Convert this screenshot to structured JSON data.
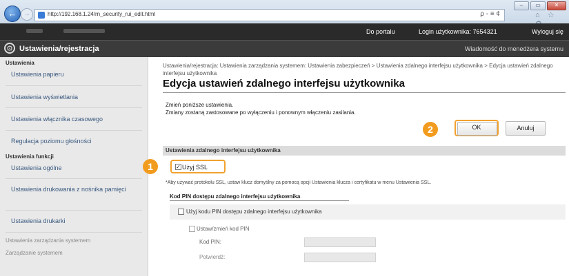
{
  "browser": {
    "url": "http://192.168.1.24/rn_security_rui_edit.html",
    "addr_actions": "ρ - ≡ ¢",
    "home_icons": "⌂ ☆ ⚙",
    "win_min": "–",
    "win_max": "▭",
    "win_close": "✕",
    "back": "←",
    "forward": "→"
  },
  "header": {
    "portal_link": "Do portalu",
    "login_text": "Login użytkownika:  7654321",
    "logout_link": "Wyloguj się",
    "app_title": "Ustawienia/rejestracja",
    "admin_msg": "Wiadomość do menedżera systemu"
  },
  "sidebar": {
    "section1": "Ustawienia",
    "items1": [
      "Ustawienia papieru",
      "Ustawienia wyświetlania",
      "Ustawienia włącznika czasowego",
      "Regulacja poziomu głośności"
    ],
    "section2": "Ustawienia funkcji",
    "items2": [
      "Ustawienia ogólne",
      "Ustawienia drukowania z nośnika pamięci",
      "Ustawienia drukarki"
    ],
    "bottom1": "Ustawienia zarządzania systemem",
    "bottom2": "Zarządzanie systemem"
  },
  "main": {
    "breadcrumb": "Ustawienia/rejestracja: Ustawienia zarządzania systemem: Ustawienia zabezpieczeń > Ustawienia zdalnego interfejsu użytkownika > Edycja ustawień zdalnego interfejsu użytkownika",
    "title": "Edycja ustawień zdalnego interfejsu użytkownika",
    "desc1": "Zmień poniższe ustawienia.",
    "desc2": "Zmiany zostaną zastosowane po wyłączeniu i ponownym włączeniu zasilania.",
    "ok": "OK",
    "cancel": "Anuluj",
    "badge1": "1",
    "badge2": "2",
    "section": "Ustawienia zdalnego interfejsu użytkownika",
    "use_ssl": "Użyj SSL",
    "ssl_checked": "✓",
    "note": "*Aby używać protokołu SSL, ustaw klucz domyślny za pomocą opcji Ustawienia klucza i certyfikatu w menu Ustawienia SSL.",
    "pin_section": "Kod PIN dostępu zdalnego interfejsu użytkownika",
    "use_pin": "Użyj kodu PIN dostępu zdalnego interfejsu użytkownika",
    "set_pin": "Ustaw/zmień kod PIN",
    "pin_label": "Kod PIN:",
    "confirm_label": "Potwierdź:"
  }
}
